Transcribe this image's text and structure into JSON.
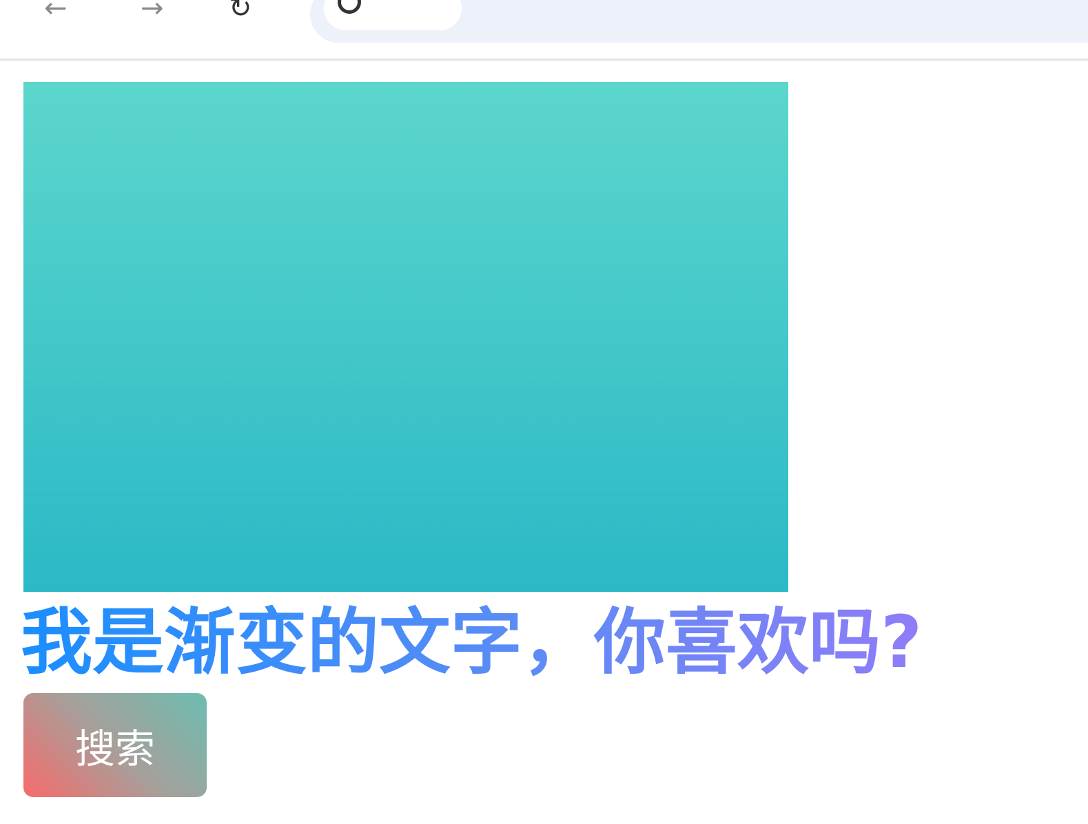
{
  "browser": {
    "nav_back_icon": "arrow-left-icon",
    "nav_forward_icon": "arrow-right-icon",
    "reload_icon": "reload-icon",
    "site_info_icon": "info-icon"
  },
  "main": {
    "gradient_box_colors": [
      "#5cd6cc",
      "#2bb9c6"
    ],
    "gradient_text": "我是渐变的文字，你喜欢吗?",
    "gradient_text_colors": [
      "#1a8eff",
      "#5b8cf5",
      "#8f7cf8"
    ],
    "search_button_label": "搜索",
    "search_button_colors": [
      "#f76b6b",
      "#a5a09b",
      "#6cbdb0"
    ]
  }
}
